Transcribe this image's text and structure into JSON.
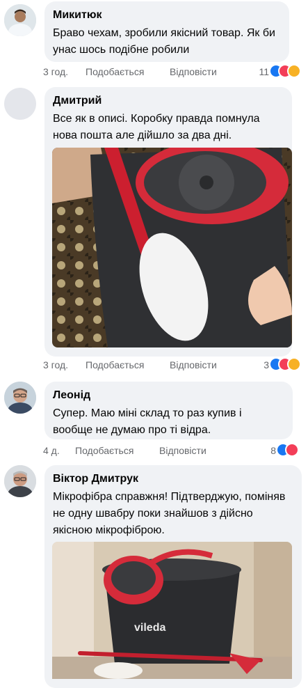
{
  "actions": {
    "like": "Подобається",
    "reply": "Відповісти"
  },
  "comments": [
    {
      "author": "Микитюк",
      "text": "Браво чехам, зробили якісний товар. Як би унас шось подібне робили",
      "time": "3 год.",
      "reactions": "11"
    },
    {
      "author": "Дмитрий",
      "text": "Все як в описі. Коробку правда помнула нова пошта але дійшло за два дні.",
      "time": "3 год.",
      "reactions": "3"
    },
    {
      "author": "Леонід",
      "text": "Супер. Маю міні склад то раз купив і вообще не думаю про ті відра.",
      "time": "4 д.",
      "reactions": "8"
    },
    {
      "author": "Віктор Дмитрук",
      "text": "Мікрофібра справжня! Підтверджую, поміняв не одну швабру поки знайшов з дійсно якісною мікрофіброю."
    }
  ],
  "colors": {
    "like": "#1877f2",
    "love": "#f33e58",
    "haha": "#f7b125",
    "bubble": "#f0f2f5",
    "meta": "#65676b"
  },
  "icons": [
    "like-icon",
    "love-icon",
    "haha-icon"
  ],
  "photo_logo": "vileda"
}
